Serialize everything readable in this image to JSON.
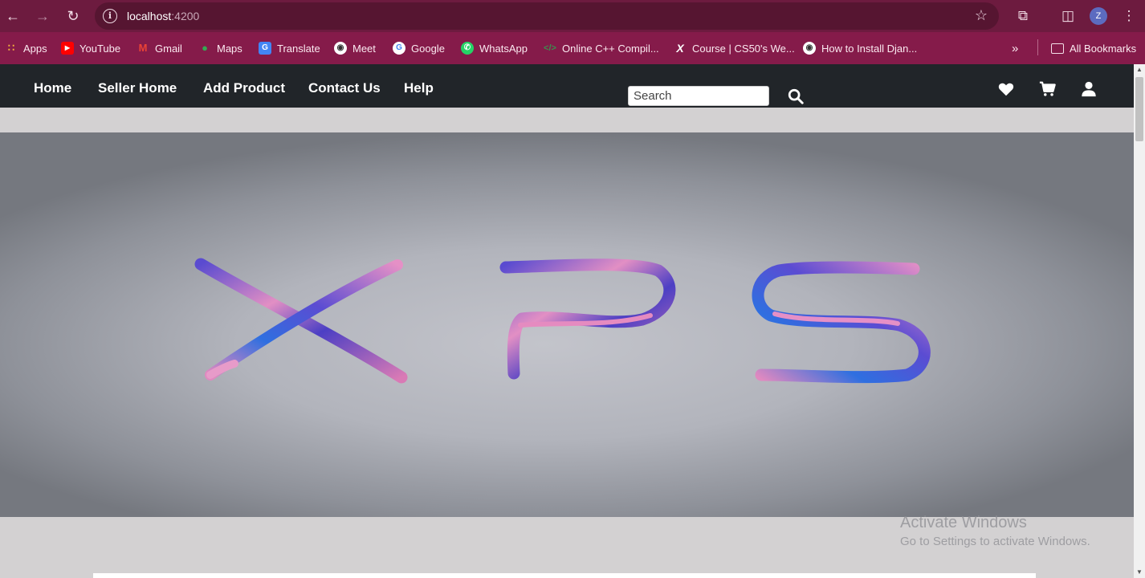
{
  "browser": {
    "url_host": "localhost",
    "url_port": ":4200",
    "profile_initial": "Z",
    "bookmarks": [
      {
        "label": "Apps",
        "icon": "apps-grid-icon",
        "color": "#e8453c"
      },
      {
        "label": "YouTube",
        "icon": "youtube-icon",
        "color": "#ff0000"
      },
      {
        "label": "Gmail",
        "icon": "gmail-icon",
        "color": "#ea4335"
      },
      {
        "label": "Maps",
        "icon": "maps-pin-icon",
        "color": "#34a853"
      },
      {
        "label": "Translate",
        "icon": "translate-icon",
        "color": "#4285f4"
      },
      {
        "label": "Meet",
        "icon": "globe-icon",
        "color": "#ffffff"
      },
      {
        "label": "Google",
        "icon": "google-icon",
        "color": "#ffffff"
      },
      {
        "label": "WhatsApp",
        "icon": "whatsapp-icon",
        "color": "#25d366"
      },
      {
        "label": "Online C++ Compil...",
        "icon": "code-icon",
        "color": "#3c8d4f"
      },
      {
        "label": "Course | CS50's We...",
        "icon": "x-logo-icon",
        "color": "#000000"
      },
      {
        "label": "How to Install Djan...",
        "icon": "globe-icon",
        "color": "#ffffff"
      }
    ],
    "all_bookmarks": "All Bookmarks"
  },
  "navbar": {
    "links": [
      "Home",
      "Seller Home",
      "Add Product",
      "Contact Us",
      "Help"
    ],
    "search_placeholder": "Search"
  },
  "hero": {
    "logo_text": "XPS"
  },
  "watermark": {
    "line1": "Activate Windows",
    "line2": "Go to Settings to activate Windows."
  },
  "colors": {
    "chrome_bar": "#6d1b3f",
    "bookmark_bar": "#851b4a",
    "navbar": "#212529",
    "logo_blue": "#5546c8",
    "logo_pink": "#e58bc0"
  }
}
